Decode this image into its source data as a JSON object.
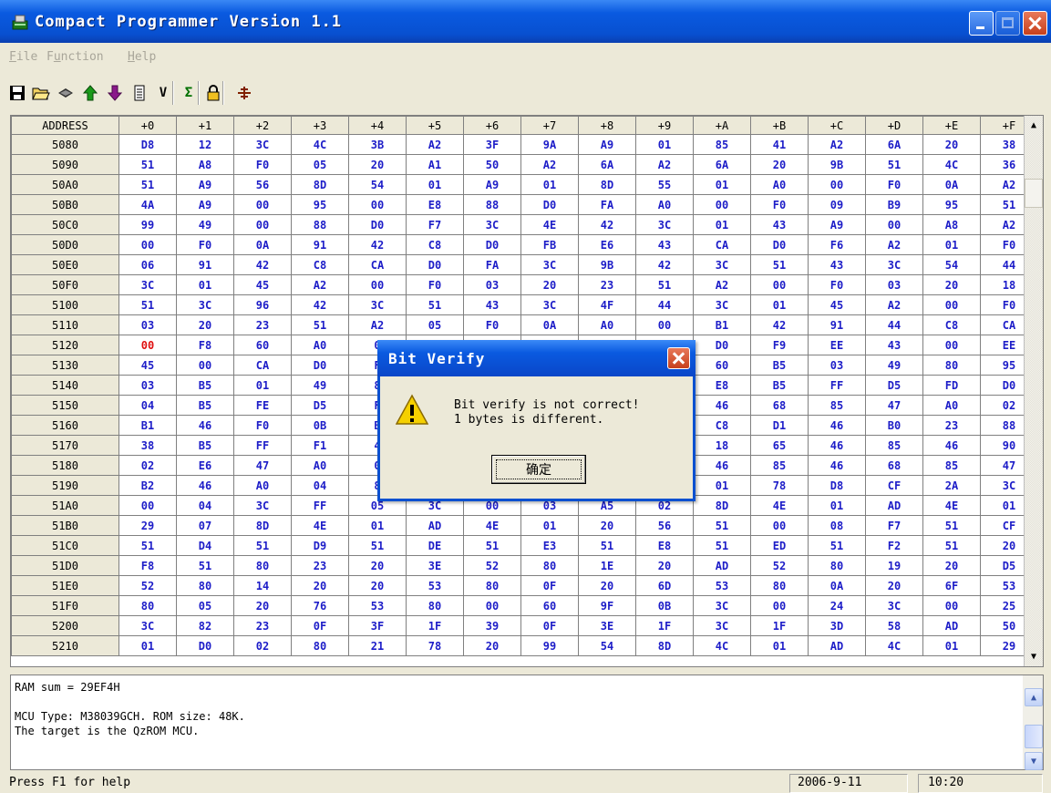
{
  "window": {
    "title": "Compact Programmer Version 1.1"
  },
  "menu": [
    {
      "label": "File",
      "hot": "F",
      "rest": "ile"
    },
    {
      "label": "Function",
      "hot": "u",
      "pre": "F",
      "rest": "nction"
    },
    {
      "label": "Help",
      "hot": "H",
      "rest": "elp"
    }
  ],
  "toolbar": {
    "icons": [
      "save-icon",
      "open-folder-icon",
      "chip-icon",
      "upload-arrow-icon",
      "download-arrow-icon",
      "blank-check-icon",
      "verify-icon",
      "checksum-icon",
      "lock-icon",
      "connect-icon"
    ],
    "labels": {
      "verify": "V",
      "checksum": "Σ"
    }
  },
  "grid": {
    "headers": [
      "ADDRESS",
      "+0",
      "+1",
      "+2",
      "+3",
      "+4",
      "+5",
      "+6",
      "+7",
      "+8",
      "+9",
      "+A",
      "+B",
      "+C",
      "+D",
      "+E",
      "+F"
    ],
    "rows": [
      [
        "5080",
        "D8",
        "12",
        "3C",
        "4C",
        "3B",
        "A2",
        "3F",
        "9A",
        "A9",
        "01",
        "85",
        "41",
        "A2",
        "6A",
        "20",
        "38"
      ],
      [
        "5090",
        "51",
        "A8",
        "F0",
        "05",
        "20",
        "A1",
        "50",
        "A2",
        "6A",
        "A2",
        "6A",
        "20",
        "9B",
        "51",
        "4C",
        "36"
      ],
      [
        "50A0",
        "51",
        "A9",
        "56",
        "8D",
        "54",
        "01",
        "A9",
        "01",
        "8D",
        "55",
        "01",
        "A0",
        "00",
        "F0",
        "0A",
        "A2"
      ],
      [
        "50B0",
        "4A",
        "A9",
        "00",
        "95",
        "00",
        "E8",
        "88",
        "D0",
        "FA",
        "A0",
        "00",
        "F0",
        "09",
        "B9",
        "95",
        "51"
      ],
      [
        "50C0",
        "99",
        "49",
        "00",
        "88",
        "D0",
        "F7",
        "3C",
        "4E",
        "42",
        "3C",
        "01",
        "43",
        "A9",
        "00",
        "A8",
        "A2"
      ],
      [
        "50D0",
        "00",
        "F0",
        "0A",
        "91",
        "42",
        "C8",
        "D0",
        "FB",
        "E6",
        "43",
        "CA",
        "D0",
        "F6",
        "A2",
        "01",
        "F0"
      ],
      [
        "50E0",
        "06",
        "91",
        "42",
        "C8",
        "CA",
        "D0",
        "FA",
        "3C",
        "9B",
        "42",
        "3C",
        "51",
        "43",
        "3C",
        "54",
        "44"
      ],
      [
        "50F0",
        "3C",
        "01",
        "45",
        "A2",
        "00",
        "F0",
        "03",
        "20",
        "23",
        "51",
        "A2",
        "00",
        "F0",
        "03",
        "20",
        "18"
      ],
      [
        "5100",
        "51",
        "3C",
        "96",
        "42",
        "3C",
        "51",
        "43",
        "3C",
        "4F",
        "44",
        "3C",
        "01",
        "45",
        "A2",
        "00",
        "F0"
      ],
      [
        "5110",
        "03",
        "20",
        "23",
        "51",
        "A2",
        "05",
        "F0",
        "0A",
        "A0",
        "00",
        "B1",
        "42",
        "91",
        "44",
        "C8",
        "CA"
      ],
      [
        "5120",
        "00",
        "F8",
        "60",
        "A0",
        "0",
        "",
        "",
        "",
        "",
        "",
        "D0",
        "F9",
        "EE",
        "43",
        "00",
        "EE"
      ],
      [
        "5130",
        "45",
        "00",
        "CA",
        "D0",
        "F",
        "",
        "",
        "",
        "",
        "",
        "60",
        "B5",
        "03",
        "49",
        "80",
        "95"
      ],
      [
        "5140",
        "03",
        "B5",
        "01",
        "49",
        "8",
        "",
        "",
        "",
        "",
        "",
        "E8",
        "B5",
        "FF",
        "D5",
        "FD",
        "D0"
      ],
      [
        "5150",
        "04",
        "B5",
        "FE",
        "D5",
        "F",
        "",
        "",
        "",
        "",
        "",
        "46",
        "68",
        "85",
        "47",
        "A0",
        "02"
      ],
      [
        "5160",
        "B1",
        "46",
        "F0",
        "0B",
        "B",
        "",
        "",
        "",
        "",
        "",
        "C8",
        "D1",
        "46",
        "B0",
        "23",
        "88"
      ],
      [
        "5170",
        "38",
        "B5",
        "FF",
        "F1",
        "4",
        "",
        "",
        "",
        "",
        "",
        "18",
        "65",
        "46",
        "85",
        "46",
        "90"
      ],
      [
        "5180",
        "02",
        "E6",
        "47",
        "A0",
        "0",
        "",
        "",
        "",
        "",
        "",
        "46",
        "85",
        "46",
        "68",
        "85",
        "47"
      ],
      [
        "5190",
        "B2",
        "46",
        "A0",
        "04",
        "8",
        "",
        "",
        "",
        "",
        "",
        "01",
        "78",
        "D8",
        "CF",
        "2A",
        "3C"
      ],
      [
        "51A0",
        "00",
        "04",
        "3C",
        "FF",
        "05",
        "3C",
        "00",
        "03",
        "A5",
        "02",
        "8D",
        "4E",
        "01",
        "AD",
        "4E",
        "01"
      ],
      [
        "51B0",
        "29",
        "07",
        "8D",
        "4E",
        "01",
        "AD",
        "4E",
        "01",
        "20",
        "56",
        "51",
        "00",
        "08",
        "F7",
        "51",
        "CF"
      ],
      [
        "51C0",
        "51",
        "D4",
        "51",
        "D9",
        "51",
        "DE",
        "51",
        "E3",
        "51",
        "E8",
        "51",
        "ED",
        "51",
        "F2",
        "51",
        "20"
      ],
      [
        "51D0",
        "F8",
        "51",
        "80",
        "23",
        "20",
        "3E",
        "52",
        "80",
        "1E",
        "20",
        "AD",
        "52",
        "80",
        "19",
        "20",
        "D5"
      ],
      [
        "51E0",
        "52",
        "80",
        "14",
        "20",
        "20",
        "53",
        "80",
        "0F",
        "20",
        "6D",
        "53",
        "80",
        "0A",
        "20",
        "6F",
        "53"
      ],
      [
        "51F0",
        "80",
        "05",
        "20",
        "76",
        "53",
        "80",
        "00",
        "60",
        "9F",
        "0B",
        "3C",
        "00",
        "24",
        "3C",
        "00",
        "25"
      ],
      [
        "5200",
        "3C",
        "82",
        "23",
        "0F",
        "3F",
        "1F",
        "39",
        "0F",
        "3E",
        "1F",
        "3C",
        "1F",
        "3D",
        "58",
        "AD",
        "50"
      ],
      [
        "5210",
        "01",
        "D0",
        "02",
        "80",
        "21",
        "78",
        "20",
        "99",
        "54",
        "8D",
        "4C",
        "01",
        "AD",
        "4C",
        "01",
        "29"
      ]
    ],
    "diff_cell": {
      "row": 10,
      "col": 1
    }
  },
  "log": {
    "lines": [
      "RAM sum = 29EF4H",
      "",
      "MCU Type: M38039GCH. ROM size: 48K.",
      "The target is the QzROM MCU."
    ]
  },
  "status": {
    "help": "Press F1 for help",
    "date": "2006-9-11",
    "time": "10:20"
  },
  "dialog": {
    "title": "Bit Verify",
    "message_line1": "Bit verify is not correct!",
    "message_line2": "1 bytes is different.",
    "ok_label": "确定"
  },
  "colors": {
    "titlebar": "#0a5ae0",
    "hex_value": "#1d1dc8",
    "diff_value": "#e01010"
  }
}
